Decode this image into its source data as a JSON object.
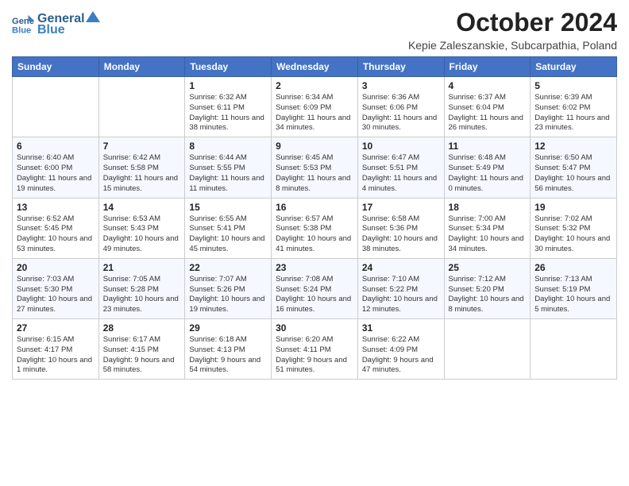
{
  "logo": {
    "line1": "General",
    "line2": "Blue"
  },
  "title": "October 2024",
  "subtitle": "Kepie Zaleszanskie, Subcarpathia, Poland",
  "days": [
    "Sunday",
    "Monday",
    "Tuesday",
    "Wednesday",
    "Thursday",
    "Friday",
    "Saturday"
  ],
  "weeks": [
    [
      {
        "day": "",
        "text": ""
      },
      {
        "day": "",
        "text": ""
      },
      {
        "day": "1",
        "text": "Sunrise: 6:32 AM\nSunset: 6:11 PM\nDaylight: 11 hours and 38 minutes."
      },
      {
        "day": "2",
        "text": "Sunrise: 6:34 AM\nSunset: 6:09 PM\nDaylight: 11 hours and 34 minutes."
      },
      {
        "day": "3",
        "text": "Sunrise: 6:36 AM\nSunset: 6:06 PM\nDaylight: 11 hours and 30 minutes."
      },
      {
        "day": "4",
        "text": "Sunrise: 6:37 AM\nSunset: 6:04 PM\nDaylight: 11 hours and 26 minutes."
      },
      {
        "day": "5",
        "text": "Sunrise: 6:39 AM\nSunset: 6:02 PM\nDaylight: 11 hours and 23 minutes."
      }
    ],
    [
      {
        "day": "6",
        "text": "Sunrise: 6:40 AM\nSunset: 6:00 PM\nDaylight: 11 hours and 19 minutes."
      },
      {
        "day": "7",
        "text": "Sunrise: 6:42 AM\nSunset: 5:58 PM\nDaylight: 11 hours and 15 minutes."
      },
      {
        "day": "8",
        "text": "Sunrise: 6:44 AM\nSunset: 5:55 PM\nDaylight: 11 hours and 11 minutes."
      },
      {
        "day": "9",
        "text": "Sunrise: 6:45 AM\nSunset: 5:53 PM\nDaylight: 11 hours and 8 minutes."
      },
      {
        "day": "10",
        "text": "Sunrise: 6:47 AM\nSunset: 5:51 PM\nDaylight: 11 hours and 4 minutes."
      },
      {
        "day": "11",
        "text": "Sunrise: 6:48 AM\nSunset: 5:49 PM\nDaylight: 11 hours and 0 minutes."
      },
      {
        "day": "12",
        "text": "Sunrise: 6:50 AM\nSunset: 5:47 PM\nDaylight: 10 hours and 56 minutes."
      }
    ],
    [
      {
        "day": "13",
        "text": "Sunrise: 6:52 AM\nSunset: 5:45 PM\nDaylight: 10 hours and 53 minutes."
      },
      {
        "day": "14",
        "text": "Sunrise: 6:53 AM\nSunset: 5:43 PM\nDaylight: 10 hours and 49 minutes."
      },
      {
        "day": "15",
        "text": "Sunrise: 6:55 AM\nSunset: 5:41 PM\nDaylight: 10 hours and 45 minutes."
      },
      {
        "day": "16",
        "text": "Sunrise: 6:57 AM\nSunset: 5:38 PM\nDaylight: 10 hours and 41 minutes."
      },
      {
        "day": "17",
        "text": "Sunrise: 6:58 AM\nSunset: 5:36 PM\nDaylight: 10 hours and 38 minutes."
      },
      {
        "day": "18",
        "text": "Sunrise: 7:00 AM\nSunset: 5:34 PM\nDaylight: 10 hours and 34 minutes."
      },
      {
        "day": "19",
        "text": "Sunrise: 7:02 AM\nSunset: 5:32 PM\nDaylight: 10 hours and 30 minutes."
      }
    ],
    [
      {
        "day": "20",
        "text": "Sunrise: 7:03 AM\nSunset: 5:30 PM\nDaylight: 10 hours and 27 minutes."
      },
      {
        "day": "21",
        "text": "Sunrise: 7:05 AM\nSunset: 5:28 PM\nDaylight: 10 hours and 23 minutes."
      },
      {
        "day": "22",
        "text": "Sunrise: 7:07 AM\nSunset: 5:26 PM\nDaylight: 10 hours and 19 minutes."
      },
      {
        "day": "23",
        "text": "Sunrise: 7:08 AM\nSunset: 5:24 PM\nDaylight: 10 hours and 16 minutes."
      },
      {
        "day": "24",
        "text": "Sunrise: 7:10 AM\nSunset: 5:22 PM\nDaylight: 10 hours and 12 minutes."
      },
      {
        "day": "25",
        "text": "Sunrise: 7:12 AM\nSunset: 5:20 PM\nDaylight: 10 hours and 8 minutes."
      },
      {
        "day": "26",
        "text": "Sunrise: 7:13 AM\nSunset: 5:19 PM\nDaylight: 10 hours and 5 minutes."
      }
    ],
    [
      {
        "day": "27",
        "text": "Sunrise: 6:15 AM\nSunset: 4:17 PM\nDaylight: 10 hours and 1 minute."
      },
      {
        "day": "28",
        "text": "Sunrise: 6:17 AM\nSunset: 4:15 PM\nDaylight: 9 hours and 58 minutes."
      },
      {
        "day": "29",
        "text": "Sunrise: 6:18 AM\nSunset: 4:13 PM\nDaylight: 9 hours and 54 minutes."
      },
      {
        "day": "30",
        "text": "Sunrise: 6:20 AM\nSunset: 4:11 PM\nDaylight: 9 hours and 51 minutes."
      },
      {
        "day": "31",
        "text": "Sunrise: 6:22 AM\nSunset: 4:09 PM\nDaylight: 9 hours and 47 minutes."
      },
      {
        "day": "",
        "text": ""
      },
      {
        "day": "",
        "text": ""
      }
    ]
  ]
}
